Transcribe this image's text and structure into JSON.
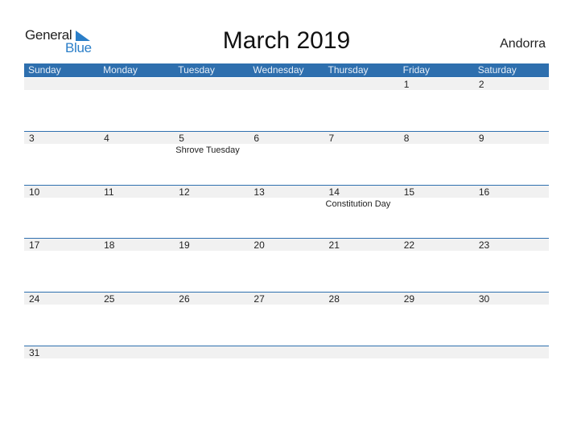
{
  "logo": {
    "general": "General",
    "blue": "Blue"
  },
  "title": "March 2019",
  "country": "Andorra",
  "colors": {
    "accent": "#2e6fae",
    "band": "#f1f1f1",
    "logo_blue": "#2a7ec8"
  },
  "weekdays": [
    "Sunday",
    "Monday",
    "Tuesday",
    "Wednesday",
    "Thursday",
    "Friday",
    "Saturday"
  ],
  "weeks": [
    [
      {
        "day": ""
      },
      {
        "day": ""
      },
      {
        "day": ""
      },
      {
        "day": ""
      },
      {
        "day": ""
      },
      {
        "day": "1"
      },
      {
        "day": "2"
      }
    ],
    [
      {
        "day": "3"
      },
      {
        "day": "4"
      },
      {
        "day": "5",
        "event": "Shrove Tuesday"
      },
      {
        "day": "6"
      },
      {
        "day": "7"
      },
      {
        "day": "8"
      },
      {
        "day": "9"
      }
    ],
    [
      {
        "day": "10"
      },
      {
        "day": "11"
      },
      {
        "day": "12"
      },
      {
        "day": "13"
      },
      {
        "day": "14",
        "event": "Constitution Day"
      },
      {
        "day": "15"
      },
      {
        "day": "16"
      }
    ],
    [
      {
        "day": "17"
      },
      {
        "day": "18"
      },
      {
        "day": "19"
      },
      {
        "day": "20"
      },
      {
        "day": "21"
      },
      {
        "day": "22"
      },
      {
        "day": "23"
      }
    ],
    [
      {
        "day": "24"
      },
      {
        "day": "25"
      },
      {
        "day": "26"
      },
      {
        "day": "27"
      },
      {
        "day": "28"
      },
      {
        "day": "29"
      },
      {
        "day": "30"
      }
    ],
    [
      {
        "day": "31"
      },
      {
        "day": ""
      },
      {
        "day": ""
      },
      {
        "day": ""
      },
      {
        "day": ""
      },
      {
        "day": ""
      },
      {
        "day": ""
      }
    ]
  ]
}
